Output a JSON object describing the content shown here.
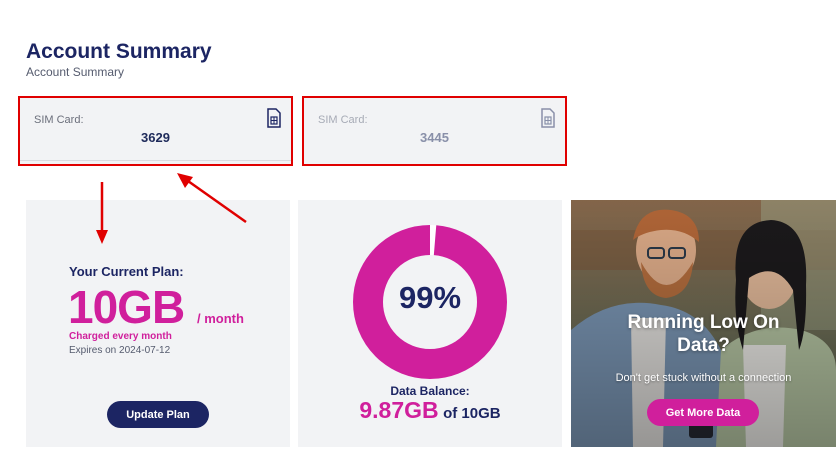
{
  "header": {
    "title": "Account Summary",
    "subtitle": "Account Summary"
  },
  "sim_cards": [
    {
      "label": "SIM Card:",
      "number": "3629",
      "icon": "sim-card-icon",
      "active": true
    },
    {
      "label": "SIM Card:",
      "number": "3445",
      "icon": "sim-card-icon",
      "active": false
    }
  ],
  "plan": {
    "label": "Your Current Plan:",
    "amount": "10GB",
    "unit": "/ month",
    "charge": "Charged every month",
    "expiry": "Expires on 2024-07-12",
    "button": "Update Plan"
  },
  "balance": {
    "percent_label": "99%",
    "fraction_remaining": 0.987,
    "label": "Data Balance:",
    "value": "9.87GB",
    "total": "of 10GB"
  },
  "promo": {
    "title_line1": "Running Low On",
    "title_line2": "Data?",
    "subtitle": "Don't get stuck without a connection",
    "button": "Get More Data"
  },
  "colors": {
    "navy": "#1c2563",
    "magenta": "#d01f9c",
    "panel": "#f2f3f5",
    "annotation_red": "#e00000"
  }
}
